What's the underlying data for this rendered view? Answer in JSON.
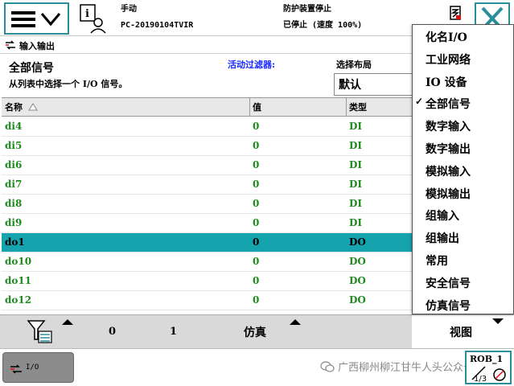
{
  "status": {
    "mode": "手动",
    "controller": "PC-20190104TVIR",
    "safety": "防护装置停止",
    "run_state": "已停止 (速度 100%)"
  },
  "window": {
    "tab_label": "输入输出"
  },
  "header": {
    "title": "全部信号",
    "subtitle": "从列表中选择一个 I/O 信号。",
    "filter_label": "活动过滤器:",
    "layout_label": "选择布局",
    "layout_value": "默认"
  },
  "table": {
    "columns": {
      "name": "名称",
      "value": "值",
      "type": "类型"
    },
    "rows": [
      {
        "name": "di4",
        "value": "0",
        "type": "DI"
      },
      {
        "name": "di5",
        "value": "0",
        "type": "DI"
      },
      {
        "name": "di6",
        "value": "0",
        "type": "DI"
      },
      {
        "name": "di7",
        "value": "0",
        "type": "DI"
      },
      {
        "name": "di8",
        "value": "0",
        "type": "DI"
      },
      {
        "name": "di9",
        "value": "0",
        "type": "DI"
      },
      {
        "name": "do1",
        "value": "0",
        "type": "DO"
      },
      {
        "name": "do10",
        "value": "0",
        "type": "DO"
      },
      {
        "name": "do11",
        "value": "0",
        "type": "DO"
      },
      {
        "name": "do12",
        "value": "0",
        "type": "DO"
      }
    ],
    "selected_index": 6
  },
  "toolbar": {
    "btn_0": "0",
    "btn_1": "1",
    "simulate": "仿真",
    "view": "视图"
  },
  "dropdown": {
    "items": [
      {
        "label": "化名I/O",
        "checked": false
      },
      {
        "label": "工业网络",
        "checked": false
      },
      {
        "label": "IO 设备",
        "checked": false
      },
      {
        "label": "全部信号",
        "checked": true
      },
      {
        "label": "数字输入",
        "checked": false
      },
      {
        "label": "数字输出",
        "checked": false
      },
      {
        "label": "模拟输入",
        "checked": false
      },
      {
        "label": "模拟输出",
        "checked": false
      },
      {
        "label": "组输入",
        "checked": false
      },
      {
        "label": "组输出",
        "checked": false
      },
      {
        "label": "常用",
        "checked": false
      },
      {
        "label": "安全信号",
        "checked": false
      },
      {
        "label": "仿真信号",
        "checked": false
      }
    ],
    "check_glyph": "✓"
  },
  "taskbar": {
    "io_label": "I/O",
    "right_label": "ROB_1",
    "watermark": "广西柳州柳江甘牛人头公众号"
  },
  "colors": {
    "accent": "#2b8f99",
    "selected_row": "#15a3ad",
    "signal_text": "#1e8a1e",
    "filter_blue": "#1a2cff"
  }
}
